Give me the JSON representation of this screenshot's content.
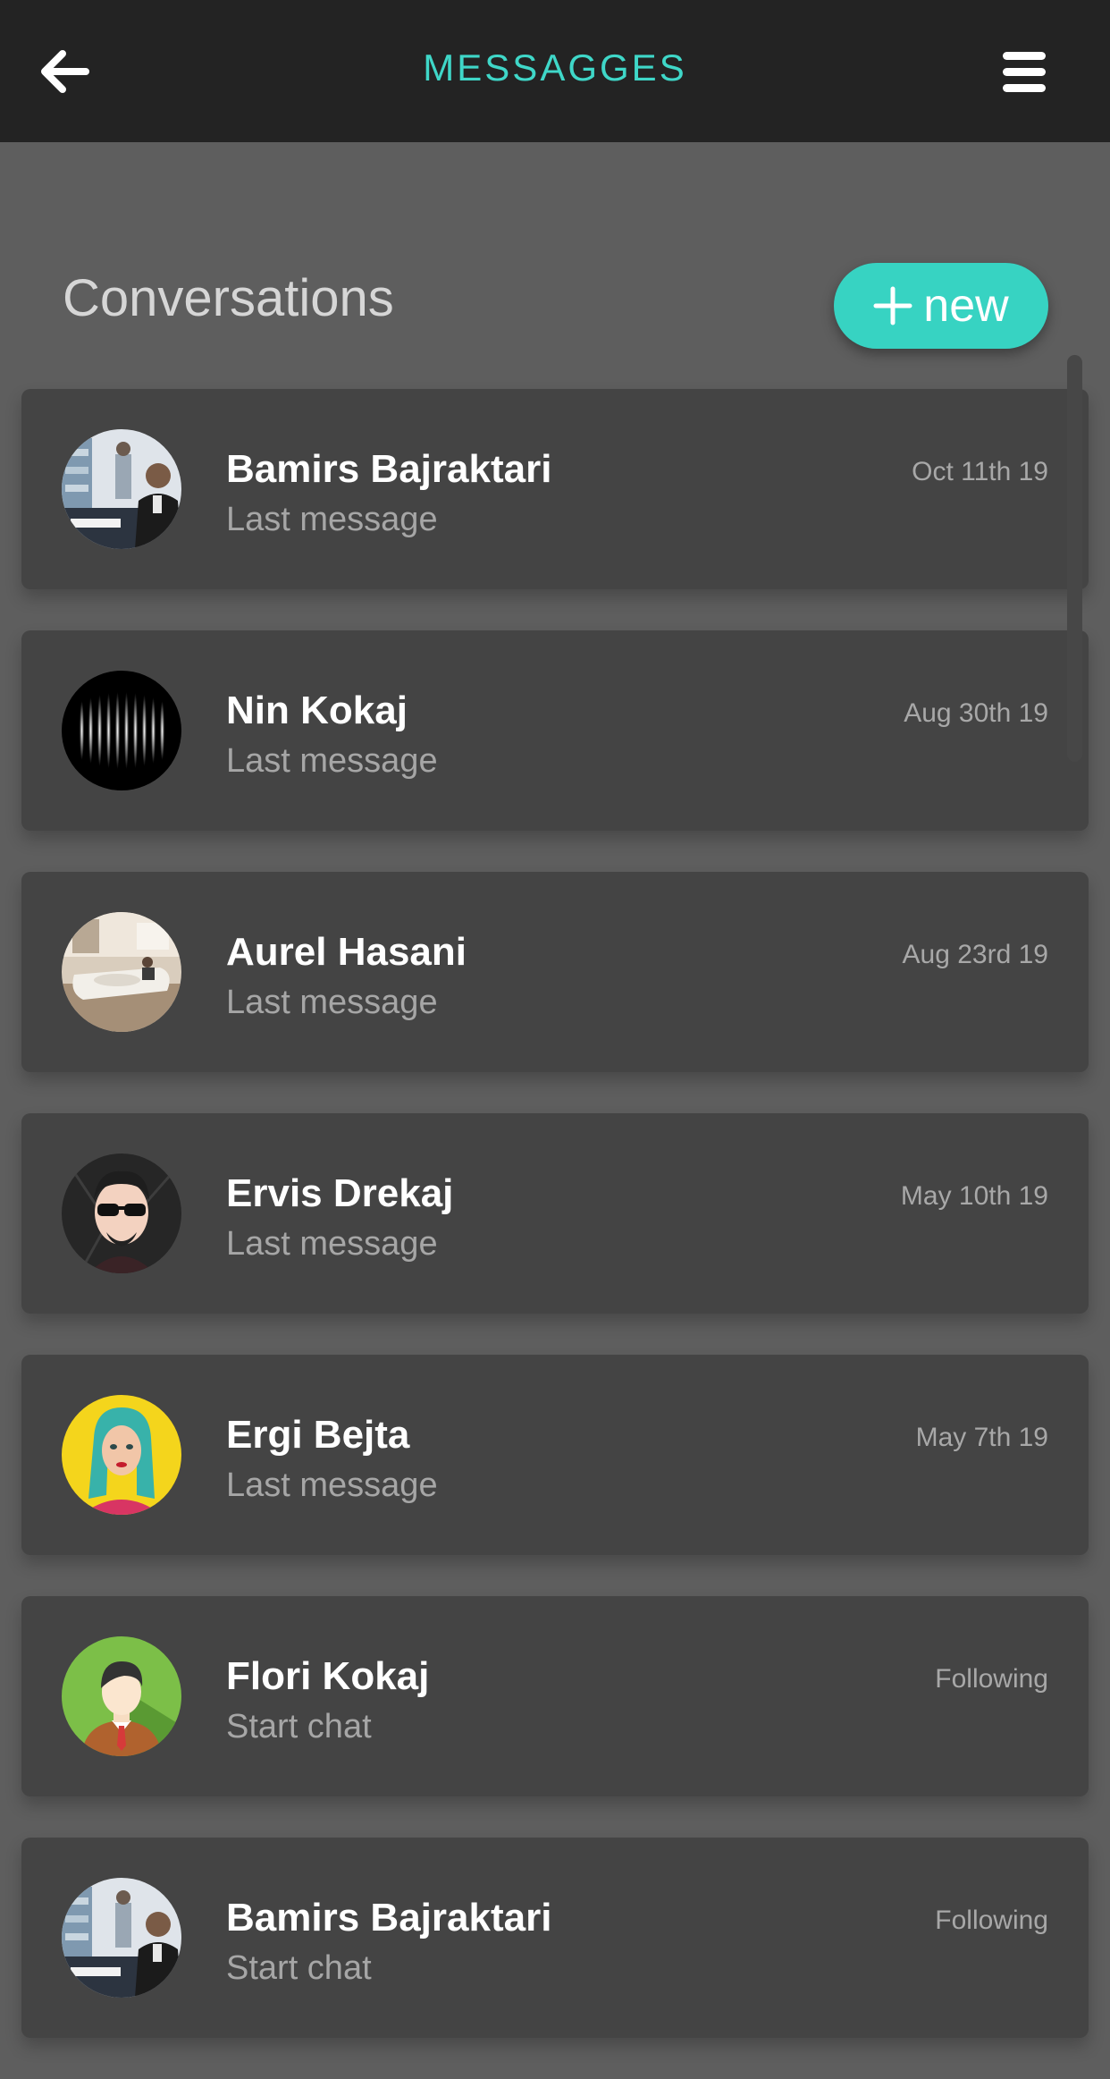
{
  "header": {
    "title": "MESSAGGES",
    "back_icon": "arrow-left-icon",
    "menu_icon": "hamburger-menu-icon"
  },
  "section": {
    "title": "Conversations",
    "new_button_label": "new",
    "new_button_icon": "plus-icon"
  },
  "colors": {
    "accent": "#37d3c2",
    "header_bg": "#232323",
    "page_bg": "#5e5e5e",
    "card_bg": "#444444"
  },
  "conversations": [
    {
      "name": "Bamirs Bajraktari",
      "subtitle": "Last message",
      "meta": "Oct 11th 19",
      "avatar": "office-photo-avatar"
    },
    {
      "name": "Nin Kokaj",
      "subtitle": "Last message",
      "meta": "Aug 30th 19",
      "avatar": "abstract-bars-avatar"
    },
    {
      "name": "Aurel Hasani",
      "subtitle": "Last message",
      "meta": "Aug 23rd 19",
      "avatar": "room-photo-avatar"
    },
    {
      "name": "Ervis Drekaj",
      "subtitle": "Last message",
      "meta": "May 10th 19",
      "avatar": "cartoon-sunglasses-avatar"
    },
    {
      "name": "Ergi Bejta",
      "subtitle": "Last message",
      "meta": "May 7th 19",
      "avatar": "pop-art-woman-avatar"
    },
    {
      "name": "Flori Kokaj",
      "subtitle": "Start chat",
      "meta": "Following",
      "avatar": "default-man-avatar"
    },
    {
      "name": "Bamirs Bajraktari",
      "subtitle": "Start chat",
      "meta": "Following",
      "avatar": "office-photo-avatar"
    }
  ]
}
